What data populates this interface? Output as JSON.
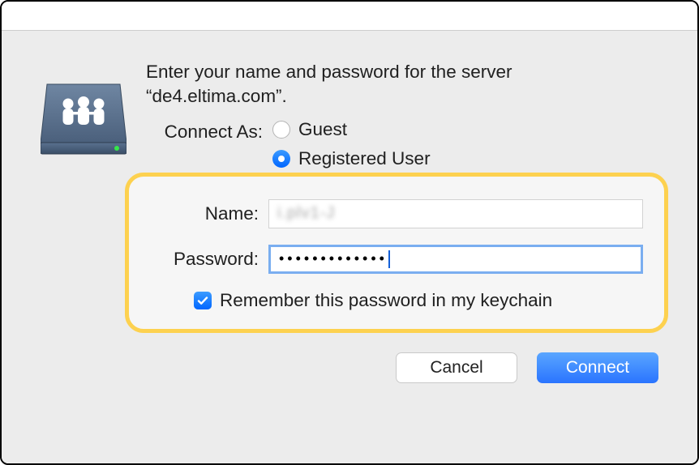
{
  "prompt_line1": "Enter your name and password for the server",
  "prompt_line2": "“de4.eltima.com”.",
  "connect_as_label": "Connect As:",
  "radio": {
    "guest": "Guest",
    "registered": "Registered User",
    "selected": "registered"
  },
  "fields": {
    "name_label": "Name:",
    "name_value": "         ",
    "password_label": "Password:",
    "password_value": "•••••••••••••"
  },
  "remember_label": "Remember this password in my keychain",
  "remember_checked": true,
  "buttons": {
    "cancel": "Cancel",
    "connect": "Connect"
  }
}
